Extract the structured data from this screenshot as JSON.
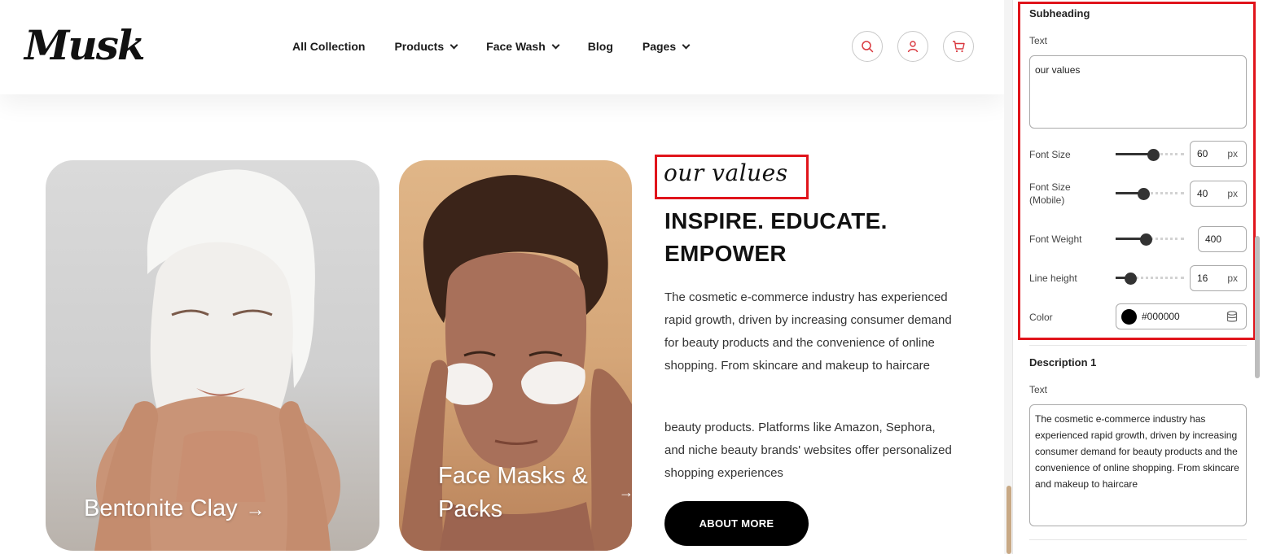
{
  "header": {
    "logo": "Musk",
    "nav": [
      {
        "label": "All Collection",
        "dropdown": false
      },
      {
        "label": "Products",
        "dropdown": true
      },
      {
        "label": "Face Wash",
        "dropdown": true
      },
      {
        "label": "Blog",
        "dropdown": false
      },
      {
        "label": "Pages",
        "dropdown": true
      }
    ],
    "icons": [
      "search-icon",
      "user-icon",
      "cart-icon"
    ],
    "accent_color": "#d9383f"
  },
  "cards": [
    {
      "title": "Bentonite Clay",
      "arrow": "→"
    },
    {
      "title": "Face Masks & Packs",
      "arrow": "→"
    }
  ],
  "section": {
    "subheading": "our values",
    "heading": "INSPIRE. EDUCATE. EMPOWER",
    "description_1": "The cosmetic e-commerce industry has experienced rapid growth, driven by increasing consumer demand for beauty products and the convenience of online shopping. From skincare and makeup to haircare",
    "description_2": "beauty products. Platforms like Amazon, Sephora, and niche beauty brands' websites offer personalized shopping experiences",
    "button": "ABOUT MORE"
  },
  "panel": {
    "subheading_section": {
      "title": "Subheading",
      "text_label": "Text",
      "text_value": "our values",
      "font_size": {
        "label": "Font Size",
        "value": "60",
        "unit": "px",
        "level": 0.55
      },
      "font_size_mobile": {
        "label": "Font Size (Mobile)",
        "value": "40",
        "unit": "px",
        "level": 0.4
      },
      "font_weight": {
        "label": "Font Weight",
        "value": "400",
        "level": 0.44
      },
      "line_height": {
        "label": "Line height",
        "value": "16",
        "unit": "px",
        "level": 0.22
      },
      "color": {
        "label": "Color",
        "value": "#000000"
      }
    },
    "description_section": {
      "title": "Description 1",
      "text_label": "Text",
      "text_value": "The cosmetic e-commerce industry has experienced rapid growth, driven by increasing consumer demand for beauty products and the convenience of online shopping. From skincare and makeup to haircare"
    }
  }
}
